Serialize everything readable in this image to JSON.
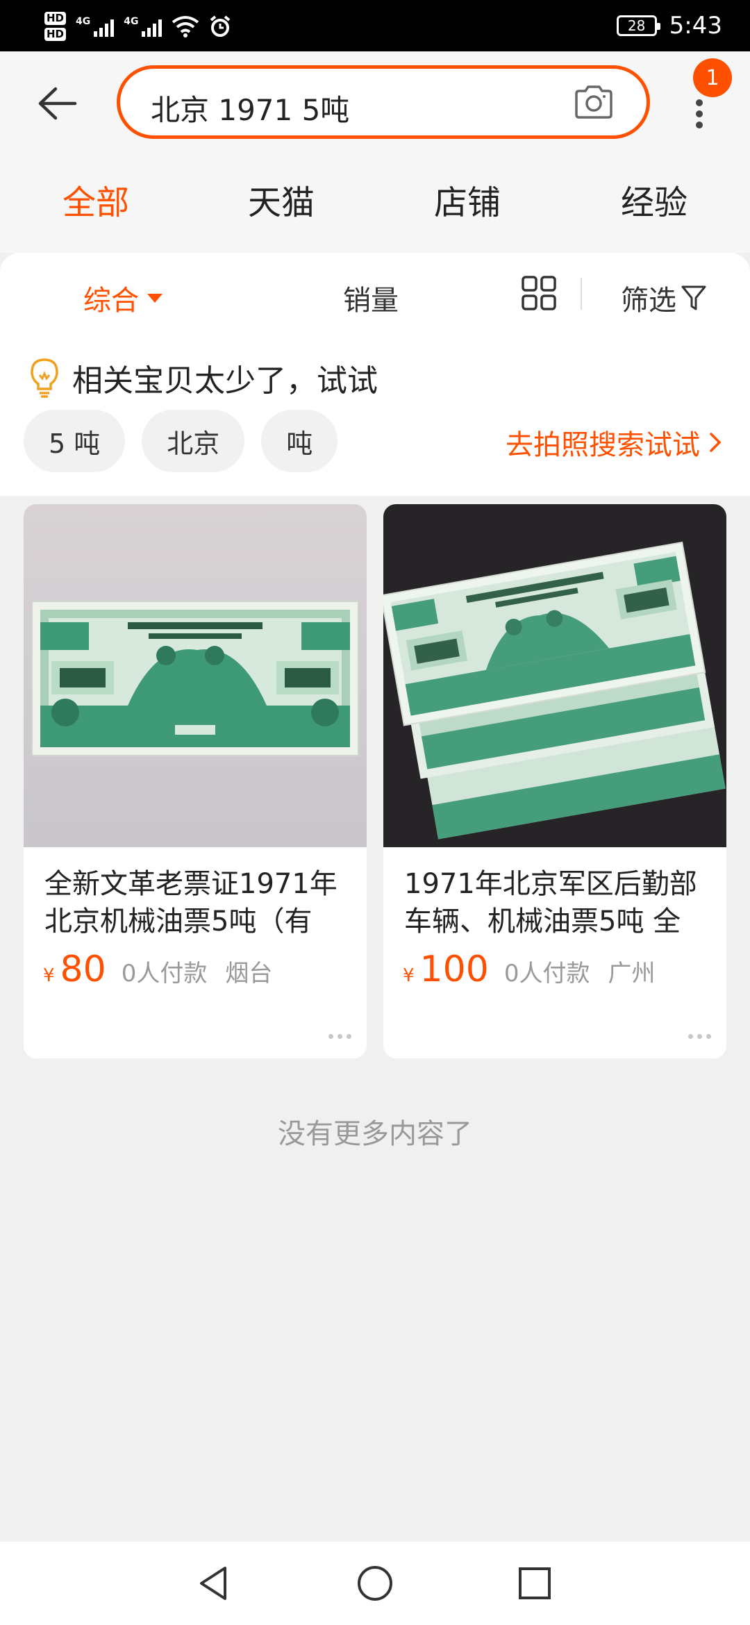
{
  "status_bar": {
    "hd_labels": [
      "HD",
      "HD"
    ],
    "sim_labels": [
      "4G",
      "4G"
    ],
    "battery": "28",
    "time": "5:43",
    "icons": [
      "wifi-icon",
      "alarm-icon"
    ]
  },
  "header": {
    "search_value": "北京 1971 5吨",
    "badge_count": "1",
    "tabs": [
      {
        "label": "全部",
        "active": true
      },
      {
        "label": "天猫",
        "active": false
      },
      {
        "label": "店铺",
        "active": false
      },
      {
        "label": "经验",
        "active": false
      }
    ]
  },
  "sort_bar": {
    "comprehensive": "综合",
    "sales": "销量",
    "filter": "筛选"
  },
  "suggestion": {
    "tip": "相关宝贝太少了，试试",
    "chips": [
      "5 吨",
      "北京",
      "吨"
    ],
    "photo_search": "去拍照搜索试试"
  },
  "products": [
    {
      "title": "全新文革老票证1971年北京机械油票5吨（有",
      "currency": "¥",
      "price": "80",
      "buyers": "0人付款",
      "location": "烟台"
    },
    {
      "title": "1971年北京军区后勤部车辆、机械油票5吨 全",
      "currency": "¥",
      "price": "100",
      "buyers": "0人付款",
      "location": "广州"
    }
  ],
  "footer_text": "没有更多内容了",
  "colors": {
    "accent": "#ff5000",
    "ticket_green": "#3e9a76",
    "background": "#f0f0f0"
  }
}
